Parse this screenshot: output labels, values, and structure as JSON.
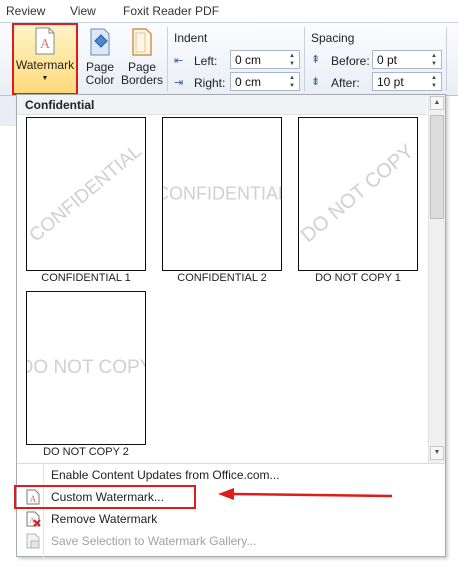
{
  "tabs": [
    "Review",
    "View",
    "Foxit Reader PDF"
  ],
  "ribbon": {
    "watermark_label": "Watermark",
    "page_color_label_1": "Page",
    "page_color_label_2": "Color",
    "page_borders_label_1": "Page",
    "page_borders_label_2": "Borders",
    "indent_title": "Indent",
    "left_label": "Left:",
    "left_value": "0 cm",
    "right_label": "Right:",
    "right_value": "0 cm",
    "spacing_title": "Spacing",
    "before_label": "Before:",
    "before_value": "0 pt",
    "after_label": "After:",
    "after_value": "10 pt"
  },
  "gallery": {
    "section_title": "Confidential",
    "items": [
      {
        "caption": "CONFIDENTIAL 1",
        "watermark": "CONFIDENTIAL",
        "style": "diagonal"
      },
      {
        "caption": "CONFIDENTIAL 2",
        "watermark": "CONFIDENTIAL",
        "style": "horizontal"
      },
      {
        "caption": "DO NOT COPY 1",
        "watermark": "DO NOT COPY",
        "style": "diagonal"
      },
      {
        "caption": "DO NOT COPY 2",
        "watermark": "DO NOT COPY",
        "style": "horizontal"
      }
    ]
  },
  "menu": {
    "enable_updates": "Enable Content Updates from Office.com...",
    "custom_watermark": "Custom Watermark...",
    "remove_watermark": "Remove Watermark",
    "save_selection": "Save Selection to Watermark Gallery..."
  },
  "colors": {
    "annotation_red": "#e01b1b",
    "watermark_gray": "#d0d0d0"
  }
}
